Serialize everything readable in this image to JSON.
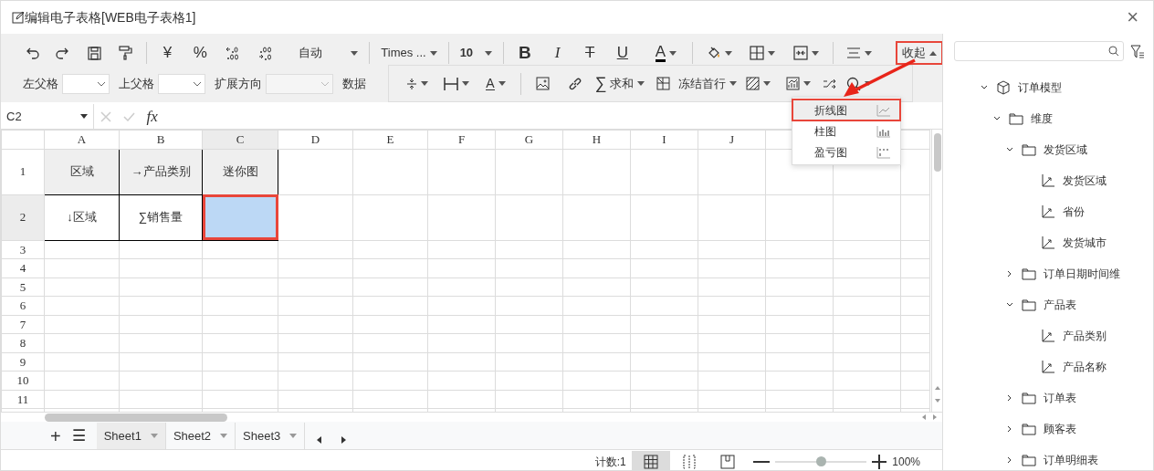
{
  "window": {
    "title": "编辑电子表格[WEB电子表格1]",
    "close": "×"
  },
  "toolbar": {
    "currency": "¥",
    "percent": "%",
    "number_format": "自动",
    "font": "Times ...",
    "font_size": "10",
    "bold": "B",
    "italic": "I",
    "strike": "T",
    "underline": "U",
    "font_color": "A",
    "collapse": {
      "label": "收起",
      "annotated": true
    }
  },
  "properties": {
    "left_parent_label": "左父格",
    "top_parent_label": "上父格",
    "expand_label": "扩展方向",
    "expand_disabled": true,
    "data_label": "数据"
  },
  "more_toolbar": {
    "text_direction": "A",
    "sum_symbol": "∑",
    "sum": "求和",
    "freeze": "冻结首行"
  },
  "chart_menu": [
    {
      "label": "折线图",
      "selected": true
    },
    {
      "label": "柱图",
      "selected": false
    },
    {
      "label": "盈亏图",
      "selected": false
    }
  ],
  "formula_bar": {
    "cell_ref": "C2",
    "fx": "fx"
  },
  "sheet": {
    "columns": [
      "A",
      "B",
      "C",
      "D",
      "E",
      "F",
      "G",
      "H",
      "I",
      "J"
    ],
    "rows": [
      {
        "label": "1",
        "cells": [
          {
            "text": "区域",
            "kind": "header",
            "selected": false
          },
          {
            "text": "→产品类别",
            "kind": "header",
            "selected": false
          },
          {
            "text": "迷你图",
            "kind": "header",
            "selected": false
          }
        ]
      },
      {
        "label": "2",
        "cells": [
          {
            "text": "↓区域",
            "kind": "field",
            "selected": false
          },
          {
            "text": "∑销售量",
            "kind": "field",
            "selected": false
          },
          {
            "kind": "field",
            "selected": true
          }
        ]
      },
      {
        "label": "3"
      },
      {
        "label": "4"
      },
      {
        "label": "5"
      },
      {
        "label": "6"
      },
      {
        "label": "7"
      },
      {
        "label": "8"
      },
      {
        "label": "9"
      },
      {
        "label": "10"
      },
      {
        "label": "11"
      }
    ]
  },
  "sheet_tabs": {
    "add": "+",
    "menu": "☰",
    "tabs": [
      {
        "label": "Sheet1",
        "selected": true
      },
      {
        "label": "Sheet2",
        "selected": false
      },
      {
        "label": "Sheet3",
        "selected": false
      }
    ]
  },
  "status_bar": {
    "count": "计数:1",
    "views": [
      {
        "selected": true
      },
      {
        "selected": false
      },
      {
        "selected": false
      }
    ],
    "zoom": {
      "level": 0.5
    },
    "zoom_text": "100%"
  },
  "tree": [
    {
      "label": "订单模型",
      "kind": "model",
      "expanded": true,
      "children": [
        {
          "label": "维度",
          "kind": "folder",
          "expanded": true,
          "children": [
            {
              "label": "发货区域",
              "kind": "folder",
              "expanded": true,
              "children": [
                {
                  "label": "发货区域",
                  "kind": "field"
                },
                {
                  "label": "省份",
                  "kind": "field"
                },
                {
                  "label": "发货城市",
                  "kind": "field"
                }
              ]
            },
            {
              "label": "订单日期时间维",
              "kind": "folder",
              "expanded": false
            },
            {
              "label": "产品表",
              "kind": "folder",
              "expanded": true,
              "children": [
                {
                  "label": "产品类别",
                  "kind": "field"
                },
                {
                  "label": "产品名称",
                  "kind": "field"
                }
              ]
            },
            {
              "label": "订单表",
              "kind": "folder",
              "expanded": false
            },
            {
              "label": "顾客表",
              "kind": "folder",
              "expanded": false
            },
            {
              "label": "订单明细表",
              "kind": "folder",
              "expanded": false
            }
          ]
        }
      ]
    }
  ]
}
